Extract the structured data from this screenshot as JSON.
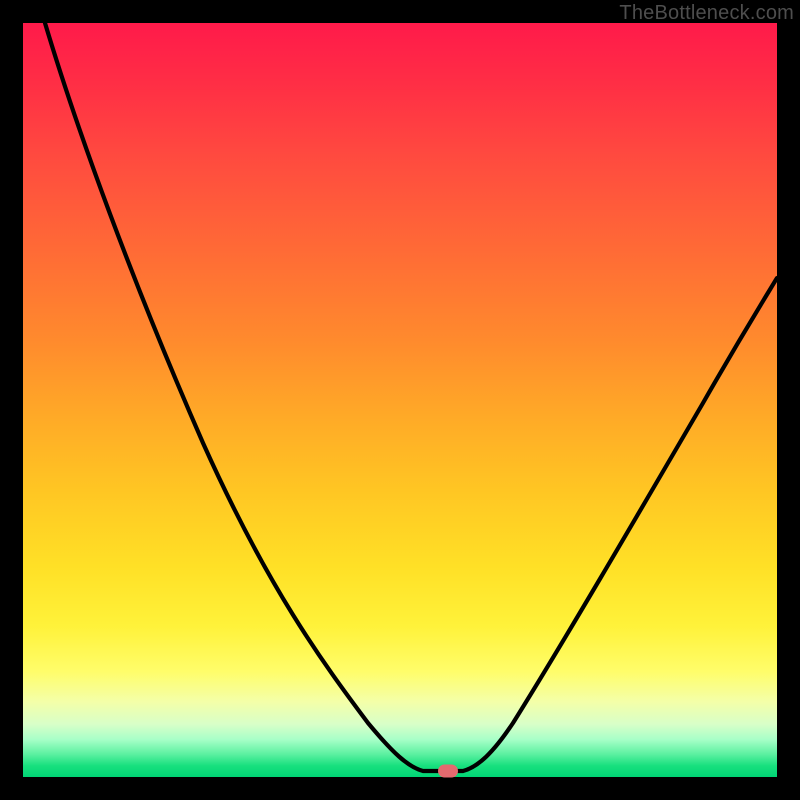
{
  "watermark": "TheBottleneck.com",
  "colors": {
    "frame": "#000000",
    "curve": "#000000",
    "marker": "#e46a6f",
    "gradient_top": "#ff1a4a",
    "gradient_bottom": "#00d575"
  },
  "chart_data": {
    "type": "line",
    "title": "",
    "xlabel": "",
    "ylabel": "",
    "xlim": [
      0,
      100
    ],
    "ylim": [
      0,
      100
    ],
    "series": [
      {
        "name": "bottleneck-curve",
        "x": [
          3,
          10,
          20,
          30,
          40,
          45,
          48,
          51,
          53,
          55,
          58,
          62,
          70,
          80,
          90,
          100
        ],
        "y": [
          100,
          82,
          60,
          40,
          22,
          13,
          7,
          3,
          1,
          0,
          0,
          3,
          14,
          33,
          53,
          70
        ]
      }
    ],
    "annotations": [
      {
        "name": "optimal-marker",
        "x": 56.5,
        "y": 0
      }
    ],
    "background": "vertical-gradient red→green (bottleneck heat scale)"
  }
}
